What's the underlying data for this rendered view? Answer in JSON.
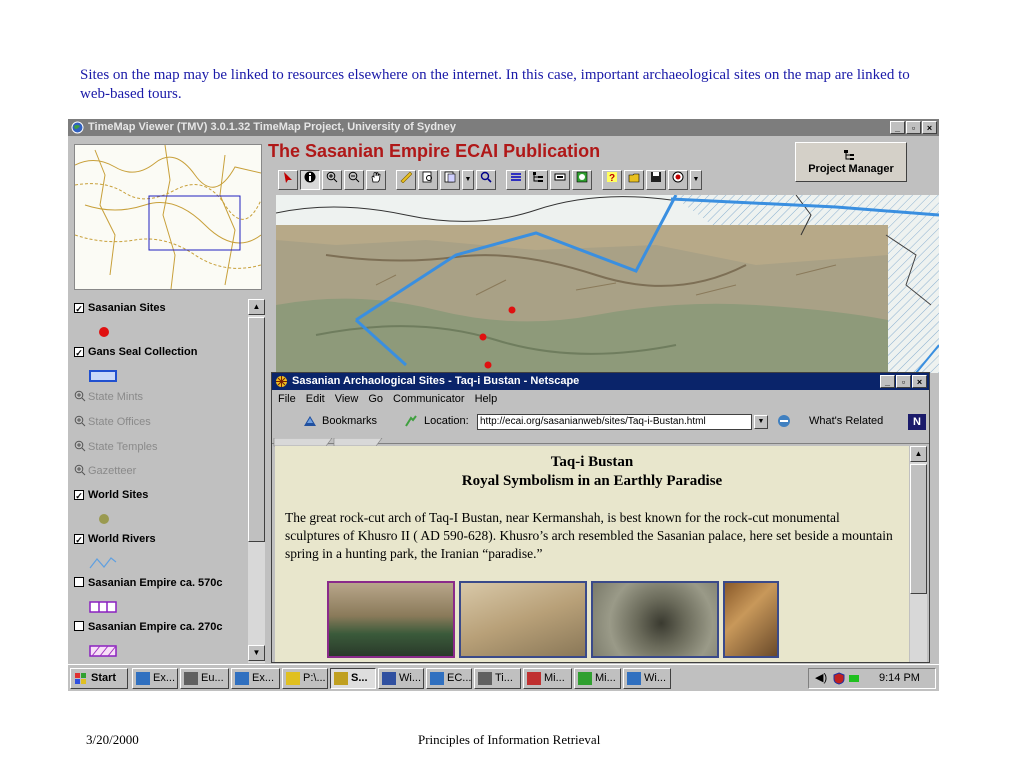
{
  "slide": {
    "caption": "Sites on the map may be linked to resources elsewhere on the internet.  In this case, important archaeological sites on the map are linked to web-based tours.",
    "footer_date": "3/20/2000",
    "footer_title": "Principles of Information Retrieval"
  },
  "app": {
    "window_title": "TimeMap Viewer (TMV) 3.0.1.32 TimeMap Project, University of Sydney",
    "publication_title": "The Sasanian Empire ECAI Publication",
    "project_manager_label": "Project Manager",
    "title_color": "#b01818",
    "window_buttons": [
      "_",
      "\u0006",
      "x"
    ],
    "toolbar_icons": [
      "arrow-icon",
      "info-icon",
      "zoom-in-icon",
      "zoom-out-icon",
      "pan-hand-icon",
      "measure-icon",
      "find-icon",
      "query-icon",
      "dropdown-icon",
      "select-icon",
      "layers-icon",
      "legend-icon",
      "view-icon",
      "timeline-icon",
      "help-icon",
      "open-icon",
      "save-icon",
      "export-icon",
      "more-icon"
    ]
  },
  "layers": [
    {
      "label": "Sasanian Sites",
      "checked": true,
      "active": true,
      "swatch": "red-dot"
    },
    {
      "label": "Gans Seal Collection",
      "checked": true,
      "active": true,
      "swatch": "blue-rect"
    },
    {
      "label": "State Mints",
      "checked": false,
      "active": false
    },
    {
      "label": "State Offices",
      "checked": false,
      "active": false
    },
    {
      "label": "State Temples",
      "checked": false,
      "active": false
    },
    {
      "label": "Gazetteer",
      "checked": false,
      "active": false
    },
    {
      "label": "World Sites",
      "checked": true,
      "active": true,
      "swatch": "olive-dot"
    },
    {
      "label": "World Rivers",
      "checked": true,
      "active": true,
      "swatch": "river-line"
    },
    {
      "label": "Sasanian Empire ca. 570c",
      "checked": false,
      "active": true,
      "swatch": "purple-grid"
    },
    {
      "label": "Sasanian Empire ca. 270c",
      "checked": false,
      "active": true,
      "swatch": "purple-hatch"
    }
  ],
  "netscape": {
    "window_title": "Sasanian Archaological Sites - Taq-i Bustan - Netscape",
    "menu": [
      "File",
      "Edit",
      "View",
      "Go",
      "Communicator",
      "Help"
    ],
    "bookmarks_label": "Bookmarks",
    "location_label": "Location:",
    "location_url": "http://ecai.org/sasanianweb/sites/Taq-i-Bustan.html",
    "whats_related_label": "What's Related",
    "page_heading": "Taq-i Bustan",
    "page_subheading": "Royal Symbolism in an Earthly Paradise",
    "page_paragraph": "The great rock-cut arch of Taq-I Bustan, near Kermanshah, is best known for the rock-cut monumental sculptures of Khusro II ( AD 590-628). Khusro’s arch resembled the Sasanian palace, here set beside a mountain spring in a hunting park, the Iranian “paradise.”",
    "content_bg": "#e8e6cc"
  },
  "taskbar": {
    "start_label": "Start",
    "tasks": [
      "Ex...",
      "Eu...",
      "Ex...",
      "P:\\...",
      "S...",
      "Wi...",
      "EC...",
      "Ti...",
      "Mi...",
      "Mi...",
      "Wi..."
    ],
    "clock": "9:14 PM"
  }
}
